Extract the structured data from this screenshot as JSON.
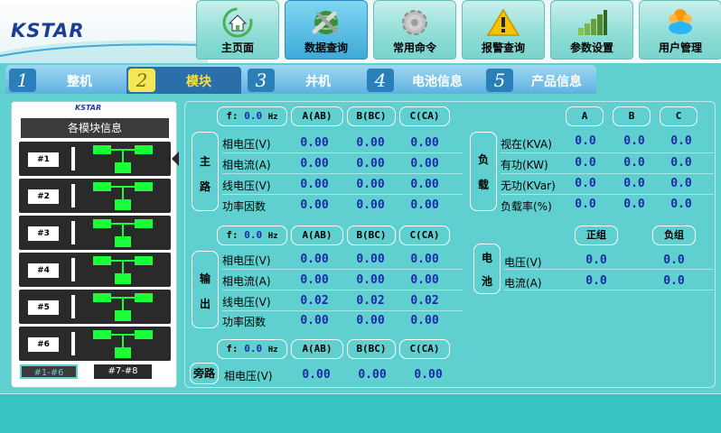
{
  "brand": {
    "logo": "KSTAR",
    "panel_logo": "KSTAR"
  },
  "nav": [
    {
      "label": "主页面",
      "icon": "home-icon"
    },
    {
      "label": "数据查询",
      "icon": "tools-globe-icon"
    },
    {
      "label": "常用命令",
      "icon": "gear-icon"
    },
    {
      "label": "报警查询",
      "icon": "warning-icon"
    },
    {
      "label": "参数设置",
      "icon": "bar-chart-icon"
    },
    {
      "label": "用户管理",
      "icon": "users-icon"
    }
  ],
  "tabs": [
    {
      "num": "1",
      "label": "整机"
    },
    {
      "num": "2",
      "label": "模块"
    },
    {
      "num": "3",
      "label": "并机"
    },
    {
      "num": "4",
      "label": "电池信息"
    },
    {
      "num": "5",
      "label": "产品信息"
    }
  ],
  "modules": {
    "title": "各模块信息",
    "items": [
      "#1",
      "#2",
      "#3",
      "#4",
      "#5",
      "#6"
    ],
    "pages": [
      "#1-#6",
      "#7-#8"
    ]
  },
  "main_input": {
    "section": "主路",
    "freq_label": "f:",
    "freq_value": "0.0",
    "freq_unit": "Hz",
    "cols": [
      "A(AB)",
      "B(BC)",
      "C(CA)"
    ],
    "rows": [
      {
        "label": "相电压(V)",
        "values": [
          "0.00",
          "0.00",
          "0.00"
        ]
      },
      {
        "label": "相电流(A)",
        "values": [
          "0.00",
          "0.00",
          "0.00"
        ]
      },
      {
        "label": "线电压(V)",
        "values": [
          "0.00",
          "0.00",
          "0.00"
        ]
      },
      {
        "label": "功率因数",
        "values": [
          "0.00",
          "0.00",
          "0.00"
        ]
      }
    ]
  },
  "output": {
    "section": "输出",
    "freq_label": "f:",
    "freq_value": "0.0",
    "freq_unit": "Hz",
    "cols": [
      "A(AB)",
      "B(BC)",
      "C(CA)"
    ],
    "rows": [
      {
        "label": "相电压(V)",
        "values": [
          "0.00",
          "0.00",
          "0.00"
        ]
      },
      {
        "label": "相电流(A)",
        "values": [
          "0.00",
          "0.00",
          "0.00"
        ]
      },
      {
        "label": "线电压(V)",
        "values": [
          "0.02",
          "0.02",
          "0.02"
        ]
      },
      {
        "label": "功率因数",
        "values": [
          "0.00",
          "0.00",
          "0.00"
        ]
      }
    ]
  },
  "bypass": {
    "section": "旁路",
    "freq_label": "f:",
    "freq_value": "0.0",
    "freq_unit": "Hz",
    "cols": [
      "A(AB)",
      "B(BC)",
      "C(CA)"
    ],
    "rows": [
      {
        "label": "相电压(V)",
        "values": [
          "0.00",
          "0.00",
          "0.00"
        ]
      }
    ]
  },
  "load": {
    "section": "负载",
    "cols": [
      "A",
      "B",
      "C"
    ],
    "rows": [
      {
        "label": "视在(KVA)",
        "values": [
          "0.0",
          "0.0",
          "0.0"
        ]
      },
      {
        "label": "有功(KW)",
        "values": [
          "0.0",
          "0.0",
          "0.0"
        ]
      },
      {
        "label": "无功(KVar)",
        "values": [
          "0.0",
          "0.0",
          "0.0"
        ]
      },
      {
        "label": "负载率(%)",
        "values": [
          "0.0",
          "0.0",
          "0.0"
        ]
      }
    ]
  },
  "battery": {
    "section": "电池",
    "cols": [
      "正组",
      "负组"
    ],
    "rows": [
      {
        "label": "电压(V)",
        "values": [
          "0.0",
          "0.0"
        ]
      },
      {
        "label": "电流(A)",
        "values": [
          "0.0",
          "0.0"
        ]
      }
    ]
  },
  "colors": {
    "background": "#5fd0cf",
    "value": "#1c2aa8",
    "module_green": "#1aff3a",
    "active_tab_text": "#f5e04a"
  }
}
